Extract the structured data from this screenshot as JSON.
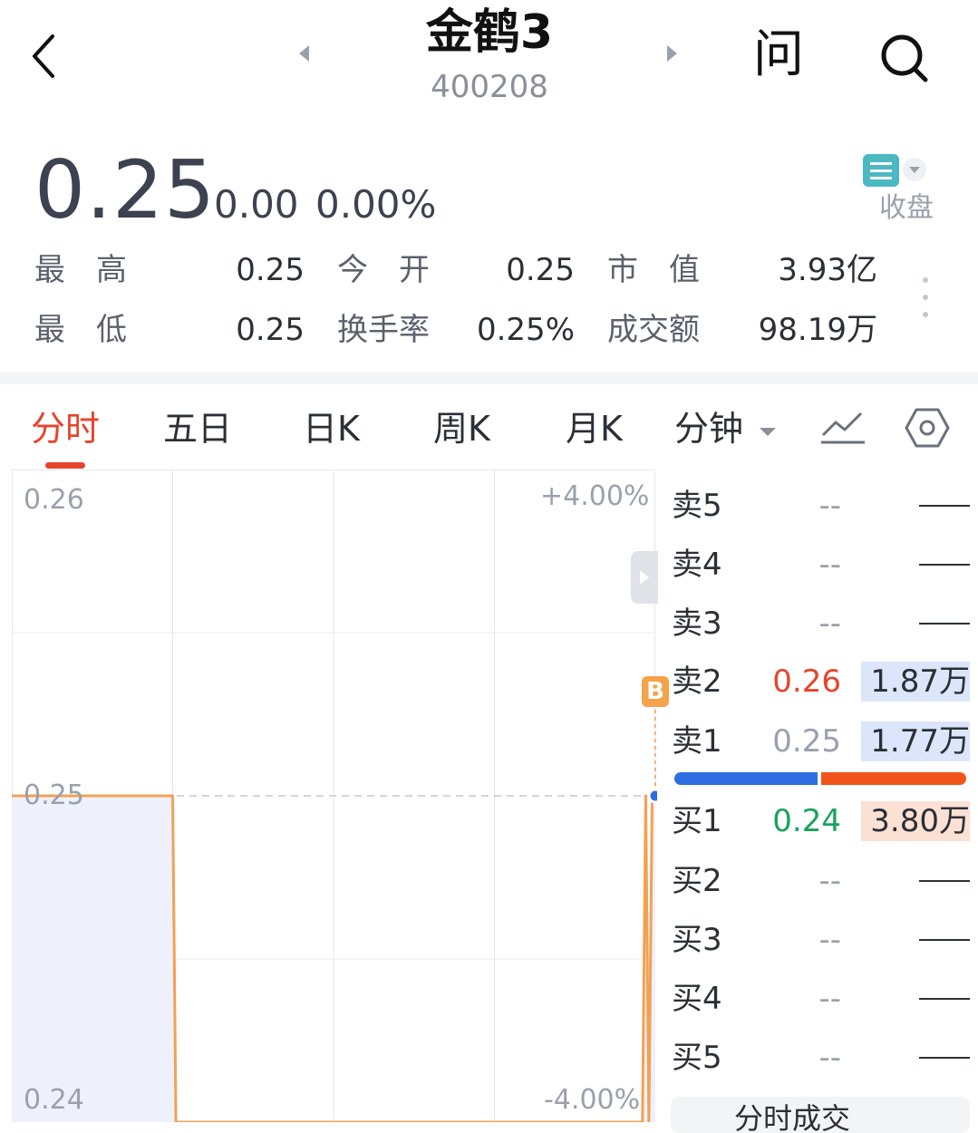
{
  "header": {
    "title": "金鹤3",
    "code": "400208",
    "ask_label": "问"
  },
  "quote": {
    "price": "0.25",
    "change": "0.00",
    "change_pct": "0.00%",
    "status": "收盘",
    "stats": [
      {
        "label": "最　高",
        "value": "0.25"
      },
      {
        "label": "今　开",
        "value": "0.25"
      },
      {
        "label": "市　值",
        "value": "3.93亿"
      },
      {
        "label": "最　低",
        "value": "0.25"
      },
      {
        "label": "换手率",
        "value": "0.25%"
      },
      {
        "label": "成交额",
        "value": "98.19万"
      }
    ]
  },
  "tabs": [
    "分时",
    "五日",
    "日K",
    "周K",
    "月K",
    "分钟"
  ],
  "active_tab": "分时",
  "chart": {
    "y_high": "0.26",
    "y_mid": "0.25",
    "y_low": "0.24",
    "pct_high": "+4.00%",
    "pct_low": "-4.00%",
    "marker": "B"
  },
  "chart_data": {
    "type": "line",
    "title": "",
    "xlabel": "",
    "ylabel": "",
    "ylim": [
      0.24,
      0.26
    ],
    "prev_close": 0.25,
    "x": [
      0,
      0.25,
      0.255,
      0.98,
      0.985,
      0.99,
      0.995,
      1.0
    ],
    "series": [
      {
        "values": [
          0.25,
          0.25,
          0.24,
          0.24,
          0.25,
          0.24,
          0.25,
          0.25
        ]
      }
    ],
    "grid": true
  },
  "order_book": {
    "sell": [
      {
        "label": "卖5",
        "price": "--",
        "volume": ""
      },
      {
        "label": "卖4",
        "price": "--",
        "volume": ""
      },
      {
        "label": "卖3",
        "price": "--",
        "volume": ""
      },
      {
        "label": "卖2",
        "price": "0.26",
        "volume": "1.87万"
      },
      {
        "label": "卖1",
        "price": "0.25",
        "volume": "1.77万"
      }
    ],
    "buy": [
      {
        "label": "买1",
        "price": "0.24",
        "volume": "3.80万"
      },
      {
        "label": "买2",
        "price": "--",
        "volume": ""
      },
      {
        "label": "买3",
        "price": "--",
        "volume": ""
      },
      {
        "label": "买4",
        "price": "--",
        "volume": ""
      },
      {
        "label": "买5",
        "price": "--",
        "volume": ""
      }
    ],
    "buy_ratio": 0.49,
    "trade_label": "分时成交"
  },
  "colors": {
    "up": "#e8432b",
    "down": "#19a35b",
    "flat": "#9aa1ad",
    "line": "#f2a154",
    "fill": "#eef1fb"
  }
}
